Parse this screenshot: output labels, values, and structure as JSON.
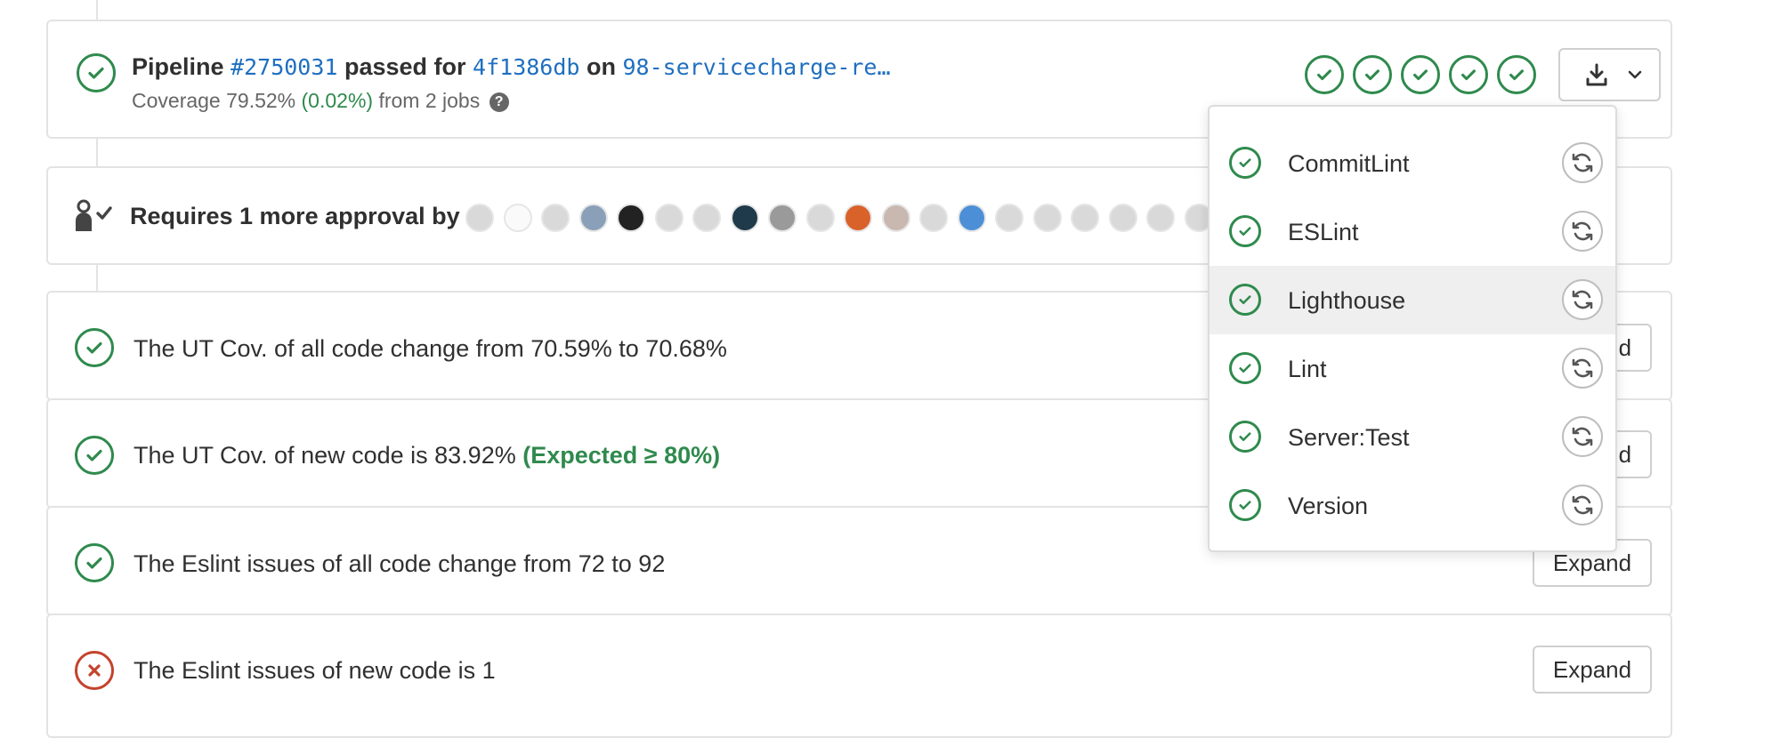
{
  "pipeline": {
    "word_pipeline": "Pipeline",
    "id": "#2750031",
    "word_passed_for": "passed for",
    "commit": "4f1386db",
    "word_on": "on",
    "branch": "98-servicecharge-re…",
    "coverage_prefix": "Coverage 79.52%",
    "coverage_delta": "(0.02%)",
    "coverage_suffix": "from 2 jobs",
    "help_icon": "question-circle-icon",
    "stage_count": 5
  },
  "approvals": {
    "text": "Requires 1 more approval by",
    "icon": "approval-user-check-icon"
  },
  "reports": [
    {
      "status": "success",
      "text": "The UT Cov. of all code change from 70.59% to 70.68%",
      "highlight": "",
      "button": "Expand"
    },
    {
      "status": "success",
      "text": "The UT Cov. of new code is 83.92%",
      "highlight": "(Expected ≥ 80%)",
      "button": "Expand"
    },
    {
      "status": "success",
      "text": "The Eslint issues of all code change from 72 to 92",
      "highlight": "",
      "button": "Expand"
    },
    {
      "status": "failed",
      "text": "The Eslint issues of new code is 1",
      "highlight": "",
      "button": "Expand"
    }
  ],
  "jobs_dropdown": {
    "items": [
      {
        "label": "CommitLint",
        "status": "passed"
      },
      {
        "label": "ESLint",
        "status": "passed"
      },
      {
        "label": "Lighthouse",
        "status": "passed"
      },
      {
        "label": "Lint",
        "status": "passed"
      },
      {
        "label": "Server:Test",
        "status": "passed"
      },
      {
        "label": "Version",
        "status": "passed"
      }
    ],
    "highlighted": "Lighthouse"
  },
  "colors": {
    "success": "#2f8a4d",
    "failed": "#c4432c",
    "link": "#1f6fbf",
    "border": "#e3e3e3"
  }
}
